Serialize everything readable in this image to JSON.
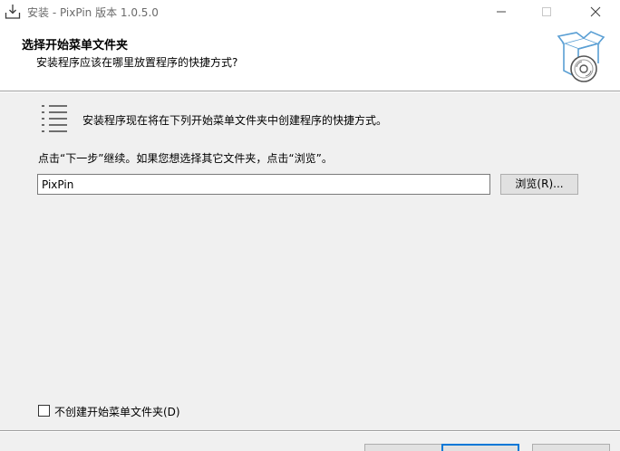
{
  "window": {
    "title": "安装 - PixPin 版本 1.0.5.0",
    "app_icon": "install-icon"
  },
  "header": {
    "title": "选择开始菜单文件夹",
    "subtitle": "安装程序应该在哪里放置程序的快捷方式?",
    "icon": "setup-box-icon"
  },
  "body": {
    "description": "安装程序现在将在下列开始菜单文件夹中创建程序的快捷方式。",
    "hint": "点击“下一步”继续。如果您想选择其它文件夹，点击“浏览”。",
    "folder_value": "PixPin",
    "browse_label": "浏览(R)...",
    "no_folder_checkbox_label": "不创建开始菜单文件夹(D)",
    "no_folder_checked": false
  }
}
